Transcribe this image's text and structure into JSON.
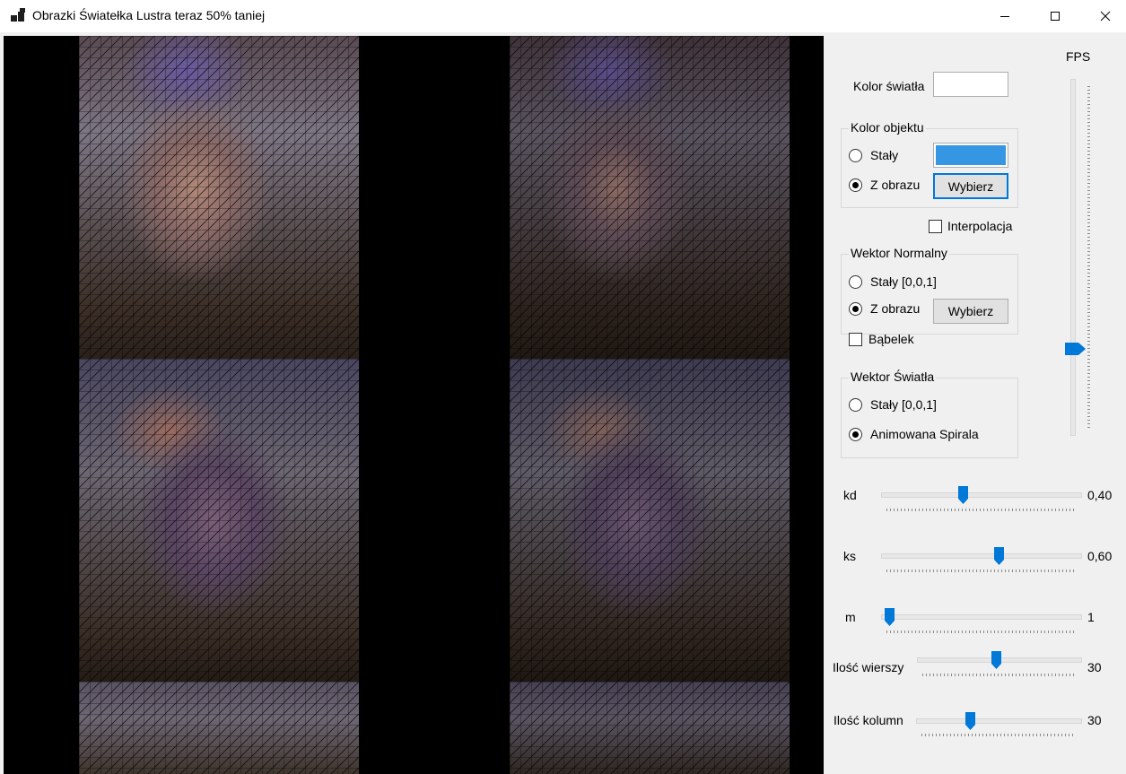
{
  "window": {
    "title": "Obrazki Światełka Lustra teraz 50% taniej"
  },
  "icons": {
    "app": "app-icon",
    "minimize": "minimize-icon",
    "maximize": "maximize-icon",
    "close": "close-icon"
  },
  "colors": {
    "accent": "#0078d7",
    "object_color": "#3596e3",
    "light_color": "#ffffff"
  },
  "fps": {
    "label": "FPS",
    "value": 0.23
  },
  "light_color": {
    "label": "Kolor światła"
  },
  "object_color": {
    "legend": "Kolor objektu",
    "options": [
      "Stały",
      "Z obrazu"
    ],
    "selected": "Z obrazu",
    "choose_label": "Wybierz"
  },
  "interpolation": {
    "label": "Interpolacja",
    "checked": false
  },
  "normal_vector": {
    "legend": "Wektor Normalny",
    "options": [
      "Stały [0,0,1]",
      "Z obrazu"
    ],
    "selected": "Z obrazu",
    "choose_label": "Wybierz"
  },
  "bubble": {
    "label": "Bąbelek",
    "checked": false
  },
  "light_vector": {
    "legend": "Wektor Światła",
    "options": [
      "Stały [0,0,1]",
      "Animowana Spirala"
    ],
    "selected": "Animowana Spirala"
  },
  "sliders": [
    {
      "label": "kd",
      "value": "0,40",
      "position": 0.4
    },
    {
      "label": "ks",
      "value": "0,60",
      "position": 0.6
    },
    {
      "label": "m",
      "value": "1",
      "position": 0.0
    },
    {
      "label": "Ilość wierszy",
      "value": "30",
      "position": 0.48
    },
    {
      "label": "Ilość kolumn",
      "value": "30",
      "position": 0.31
    }
  ]
}
